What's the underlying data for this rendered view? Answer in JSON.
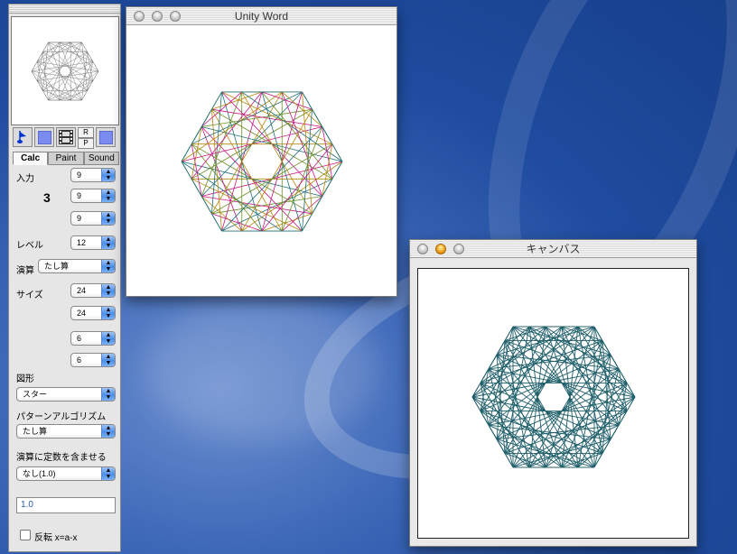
{
  "window1": {
    "title": "Unity Word"
  },
  "window2": {
    "title": "キャンバス"
  },
  "palette": {
    "tools": {
      "r": "R",
      "p": "P"
    },
    "tabs": [
      "Calc",
      "Paint",
      "Sound"
    ],
    "input_label": "入力",
    "input_value_big": "3",
    "inputs": [
      "9",
      "9",
      "9"
    ],
    "level_label": "レベル",
    "level_value": "12",
    "op_label": "演算",
    "op_value": "たし算",
    "size_label": "サイズ",
    "sizes": [
      "24",
      "24",
      "6",
      "6"
    ],
    "shape_label": "図形",
    "shape_value": "スター",
    "pattern_label": "パターンアルゴリズム",
    "pattern_value": "たし算",
    "const_label": "演算に定数を含ませる",
    "const_value": "なし(1.0)",
    "const_field": "1.0",
    "invert_label": "反転 x=a-x"
  },
  "colors": {
    "accent": "#4d8ee8",
    "drawing1": [
      "#1f6f78",
      "#b8860b",
      "#c71585",
      "#6b8e23"
    ],
    "drawing2": "#1f5f6a"
  },
  "icons": [
    "music-note-icon",
    "square-icon",
    "film-icon",
    "square-icon"
  ]
}
